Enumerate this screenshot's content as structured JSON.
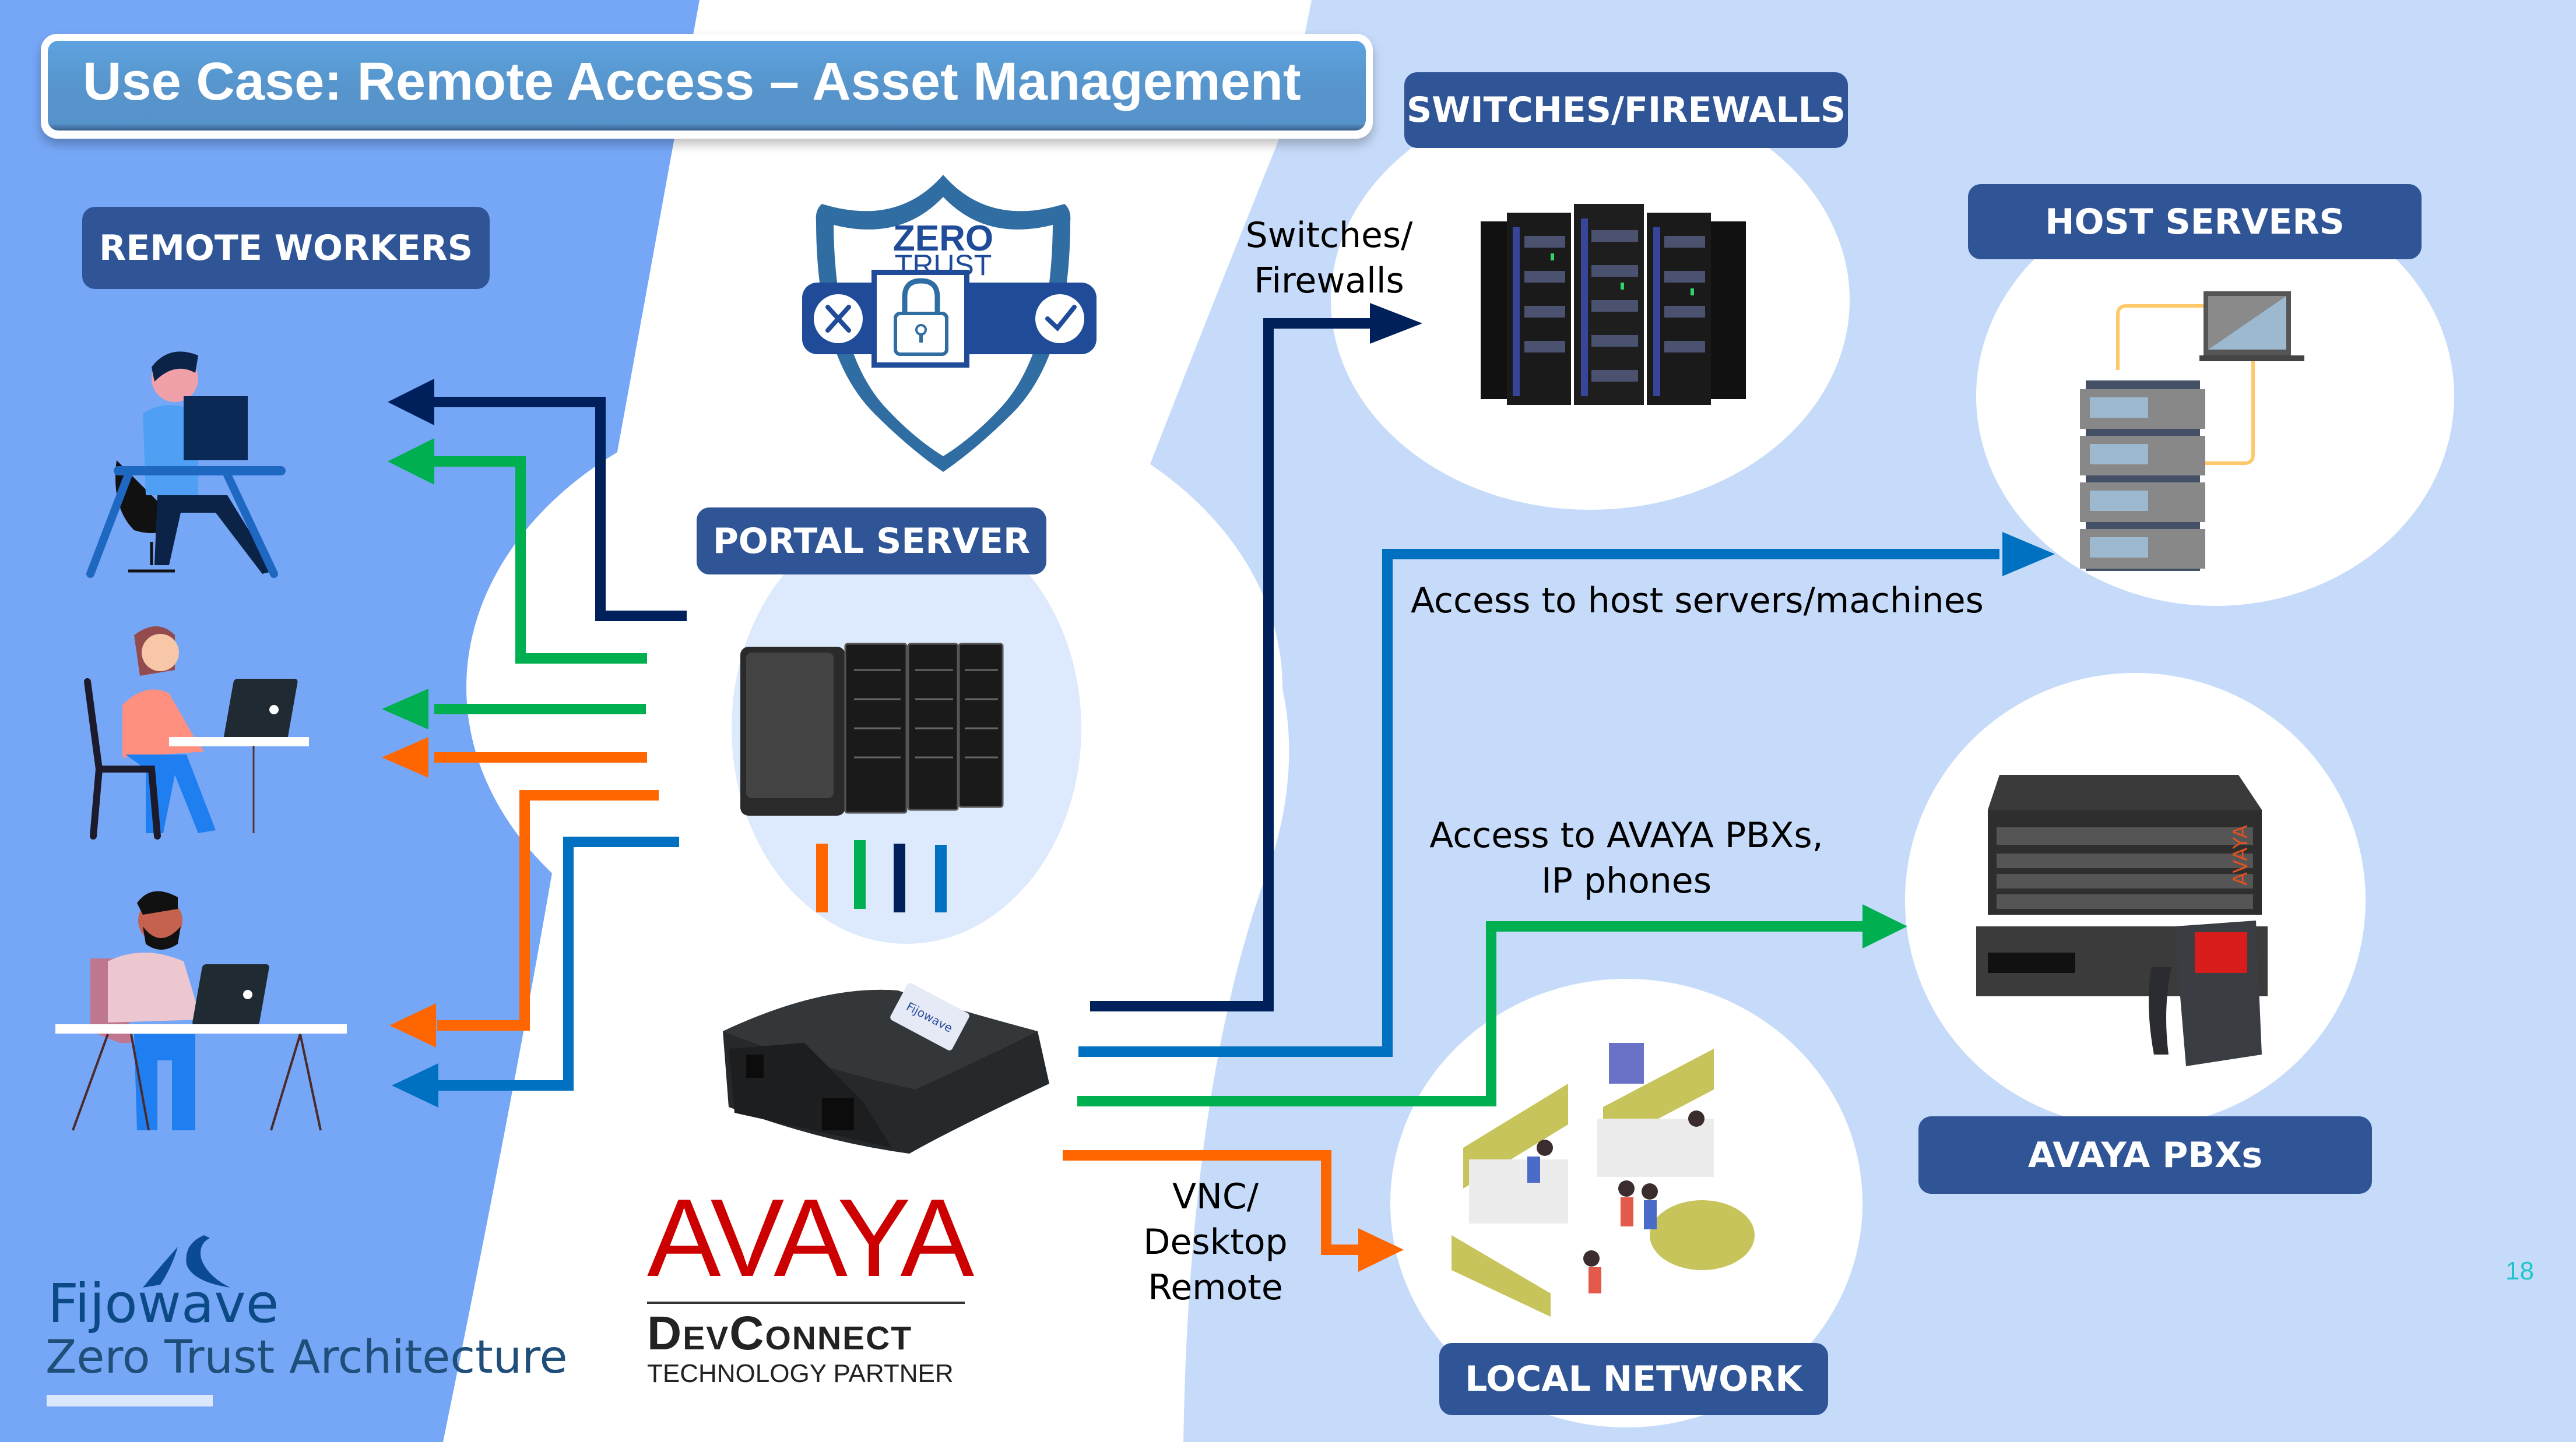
{
  "slide": {
    "title": "Use Case: Remote Access – Asset Management",
    "page_number": "18"
  },
  "labels": {
    "remote_workers": "REMOTE WORKERS",
    "portal_server": "PORTAL SERVER",
    "switches_firewalls": "SWITCHES/FIREWALLS",
    "host_servers": "HOST SERVERS",
    "avaya_pbxs": "AVAYA PBXs",
    "local_network": "LOCAL NETWORK"
  },
  "captions": {
    "switches_line1": "Switches/",
    "switches_line2": "Firewalls",
    "host_access": "Access to host servers/machines",
    "avaya_line1": "Access to AVAYA PBXs,",
    "avaya_line2": "IP phones",
    "vnc_line1": "VNC/",
    "vnc_line2": "Desktop",
    "vnc_line3": "Remote"
  },
  "zero_trust_badge": {
    "line1": "ZERO",
    "line2": "TRUST"
  },
  "device": {
    "sticker": "Fijowave"
  },
  "partner": {
    "avaya": "AVAYA",
    "devconnect": "DevConnect",
    "technology_partner": "TECHNOLOGY PARTNER"
  },
  "branding": {
    "company": "Fijowave",
    "tagline": "Zero Trust Architecture"
  },
  "colors": {
    "navy": "#00205b",
    "green": "#00b050",
    "orange": "#ff6600",
    "blue": "#0070c0",
    "label_bg": "#2f5597",
    "left_bg": "#76a7f7",
    "right_bg": "#c6dbfa",
    "page_number": "#1cc5c9"
  }
}
